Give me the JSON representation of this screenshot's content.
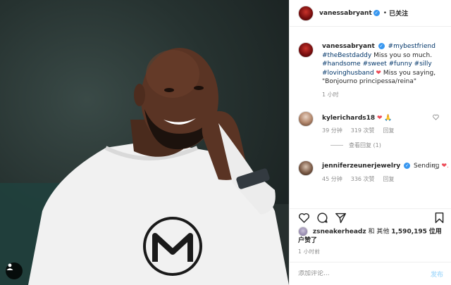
{
  "header": {
    "username": "vanessabryant",
    "verified": true,
    "follow_label": "已关注",
    "separator": "•"
  },
  "caption": {
    "username": "vanessabryant",
    "parts": [
      "#mybestfriend",
      "#theBestdaddy",
      "Miss you so much.",
      "#handsome",
      "#sweet",
      "#funny",
      "#silly",
      "#lovinghusband",
      "Miss you saying, \"Bonjourno principessa/reina\""
    ],
    "time": "1 小时"
  },
  "comments": [
    {
      "username": "kylerichards18",
      "text_emoji": "❤ 🙏",
      "time": "39 分钟",
      "likes": "319 次赞",
      "reply": "回复",
      "view_replies": "查看回复 (1)"
    },
    {
      "username": "jenniferzeunerjewelry",
      "verified": true,
      "text": "Sending",
      "text_emoji": "❤.",
      "time": "45 分钟",
      "likes": "336 次赞",
      "reply": "回复"
    }
  ],
  "likes": {
    "user": "zsneakerheadz",
    "middle": "和 其他",
    "count": "1,590,195",
    "suffix": "位用户赞了"
  },
  "posted_time": "1 小时前",
  "add_comment": {
    "placeholder": "添加评论...",
    "post_label": "发布"
  },
  "icons": {
    "like": "heart-outline-icon",
    "comment": "comment-icon",
    "share": "paper-plane-icon",
    "save": "bookmark-icon",
    "comment_like": "small-heart-icon",
    "user_tag": "person-icon"
  },
  "colors": {
    "link": "#003569",
    "heart": "#ed4956",
    "verified": "#3897f0",
    "muted": "#8e8e8e",
    "post_button": "#b2dffc"
  }
}
